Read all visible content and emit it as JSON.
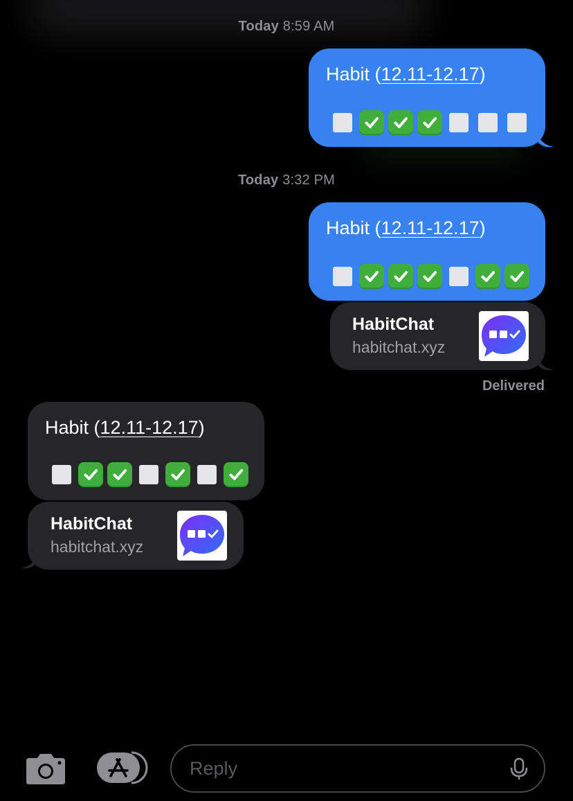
{
  "timestamps": [
    {
      "day": "Today",
      "time": "8:59 AM"
    },
    {
      "day": "Today",
      "time": "3:32 PM"
    }
  ],
  "messages": [
    {
      "id": "m1",
      "direction": "sent",
      "title_prefix": "Habit (",
      "date_range": "12.11-12.17",
      "title_suffix": ")",
      "squares": [
        "white",
        "check",
        "check",
        "check",
        "white",
        "white",
        "white"
      ]
    },
    {
      "id": "m2",
      "direction": "sent",
      "title_prefix": "Habit (",
      "date_range": "12.11-12.17",
      "title_suffix": ")",
      "squares": [
        "white",
        "check",
        "check",
        "check",
        "white",
        "check",
        "check"
      ]
    },
    {
      "id": "m3",
      "direction": "received",
      "title_prefix": "Habit (",
      "date_range": "12.11-12.17",
      "title_suffix": ")",
      "squares": [
        "white",
        "check",
        "check",
        "white",
        "check",
        "white",
        "check"
      ]
    }
  ],
  "link_previews": [
    {
      "id": "l1",
      "direction": "sent",
      "title": "HabitChat",
      "url": "habitchat.xyz"
    },
    {
      "id": "l2",
      "direction": "received",
      "title": "HabitChat",
      "url": "habitchat.xyz"
    }
  ],
  "status": {
    "delivered": "Delivered"
  },
  "composer": {
    "placeholder": "Reply"
  },
  "icons": {
    "camera": "camera-icon",
    "app_store": "app-store-icon",
    "mic": "microphone-icon",
    "check": "white-check-mark-emoji",
    "square": "white-square-emoji",
    "app_logo": "habitchat-logo-icon"
  },
  "colors": {
    "sent_bubble": "#3781f1",
    "received_bubble": "#262629",
    "check_green": "#3fae3a",
    "timestamp_gray": "#8e8e93",
    "logo_gradient_start": "#7b2ff7",
    "logo_gradient_end": "#2f6ef5"
  }
}
